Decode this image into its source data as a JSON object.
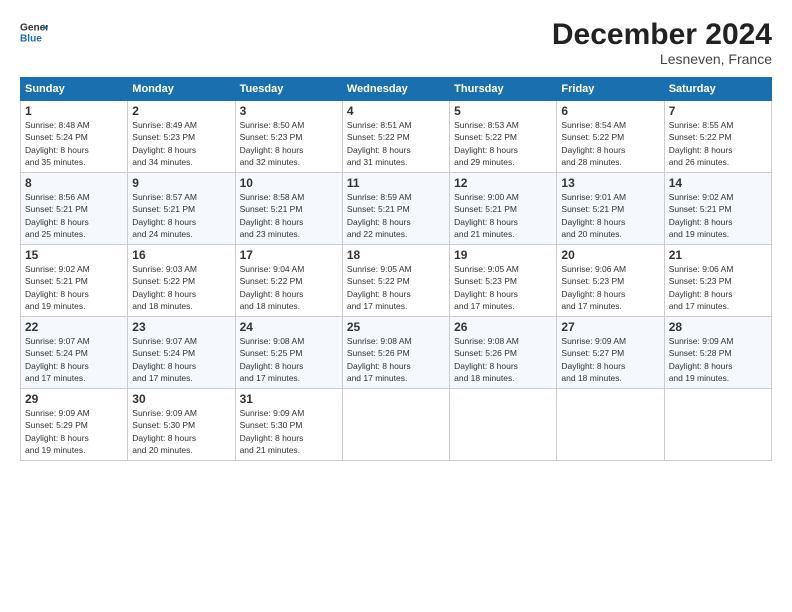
{
  "header": {
    "logo_line1": "General",
    "logo_line2": "Blue",
    "title": "December 2024",
    "subtitle": "Lesneven, France"
  },
  "columns": [
    "Sunday",
    "Monday",
    "Tuesday",
    "Wednesday",
    "Thursday",
    "Friday",
    "Saturday"
  ],
  "weeks": [
    [
      {
        "day": "1",
        "info": "Sunrise: 8:48 AM\nSunset: 5:24 PM\nDaylight: 8 hours\nand 35 minutes."
      },
      {
        "day": "2",
        "info": "Sunrise: 8:49 AM\nSunset: 5:23 PM\nDaylight: 8 hours\nand 34 minutes."
      },
      {
        "day": "3",
        "info": "Sunrise: 8:50 AM\nSunset: 5:23 PM\nDaylight: 8 hours\nand 32 minutes."
      },
      {
        "day": "4",
        "info": "Sunrise: 8:51 AM\nSunset: 5:22 PM\nDaylight: 8 hours\nand 31 minutes."
      },
      {
        "day": "5",
        "info": "Sunrise: 8:53 AM\nSunset: 5:22 PM\nDaylight: 8 hours\nand 29 minutes."
      },
      {
        "day": "6",
        "info": "Sunrise: 8:54 AM\nSunset: 5:22 PM\nDaylight: 8 hours\nand 28 minutes."
      },
      {
        "day": "7",
        "info": "Sunrise: 8:55 AM\nSunset: 5:22 PM\nDaylight: 8 hours\nand 26 minutes."
      }
    ],
    [
      {
        "day": "8",
        "info": "Sunrise: 8:56 AM\nSunset: 5:21 PM\nDaylight: 8 hours\nand 25 minutes."
      },
      {
        "day": "9",
        "info": "Sunrise: 8:57 AM\nSunset: 5:21 PM\nDaylight: 8 hours\nand 24 minutes."
      },
      {
        "day": "10",
        "info": "Sunrise: 8:58 AM\nSunset: 5:21 PM\nDaylight: 8 hours\nand 23 minutes."
      },
      {
        "day": "11",
        "info": "Sunrise: 8:59 AM\nSunset: 5:21 PM\nDaylight: 8 hours\nand 22 minutes."
      },
      {
        "day": "12",
        "info": "Sunrise: 9:00 AM\nSunset: 5:21 PM\nDaylight: 8 hours\nand 21 minutes."
      },
      {
        "day": "13",
        "info": "Sunrise: 9:01 AM\nSunset: 5:21 PM\nDaylight: 8 hours\nand 20 minutes."
      },
      {
        "day": "14",
        "info": "Sunrise: 9:02 AM\nSunset: 5:21 PM\nDaylight: 8 hours\nand 19 minutes."
      }
    ],
    [
      {
        "day": "15",
        "info": "Sunrise: 9:02 AM\nSunset: 5:21 PM\nDaylight: 8 hours\nand 19 minutes."
      },
      {
        "day": "16",
        "info": "Sunrise: 9:03 AM\nSunset: 5:22 PM\nDaylight: 8 hours\nand 18 minutes."
      },
      {
        "day": "17",
        "info": "Sunrise: 9:04 AM\nSunset: 5:22 PM\nDaylight: 8 hours\nand 18 minutes."
      },
      {
        "day": "18",
        "info": "Sunrise: 9:05 AM\nSunset: 5:22 PM\nDaylight: 8 hours\nand 17 minutes."
      },
      {
        "day": "19",
        "info": "Sunrise: 9:05 AM\nSunset: 5:23 PM\nDaylight: 8 hours\nand 17 minutes."
      },
      {
        "day": "20",
        "info": "Sunrise: 9:06 AM\nSunset: 5:23 PM\nDaylight: 8 hours\nand 17 minutes."
      },
      {
        "day": "21",
        "info": "Sunrise: 9:06 AM\nSunset: 5:23 PM\nDaylight: 8 hours\nand 17 minutes."
      }
    ],
    [
      {
        "day": "22",
        "info": "Sunrise: 9:07 AM\nSunset: 5:24 PM\nDaylight: 8 hours\nand 17 minutes."
      },
      {
        "day": "23",
        "info": "Sunrise: 9:07 AM\nSunset: 5:24 PM\nDaylight: 8 hours\nand 17 minutes."
      },
      {
        "day": "24",
        "info": "Sunrise: 9:08 AM\nSunset: 5:25 PM\nDaylight: 8 hours\nand 17 minutes."
      },
      {
        "day": "25",
        "info": "Sunrise: 9:08 AM\nSunset: 5:26 PM\nDaylight: 8 hours\nand 17 minutes."
      },
      {
        "day": "26",
        "info": "Sunrise: 9:08 AM\nSunset: 5:26 PM\nDaylight: 8 hours\nand 18 minutes."
      },
      {
        "day": "27",
        "info": "Sunrise: 9:09 AM\nSunset: 5:27 PM\nDaylight: 8 hours\nand 18 minutes."
      },
      {
        "day": "28",
        "info": "Sunrise: 9:09 AM\nSunset: 5:28 PM\nDaylight: 8 hours\nand 19 minutes."
      }
    ],
    [
      {
        "day": "29",
        "info": "Sunrise: 9:09 AM\nSunset: 5:29 PM\nDaylight: 8 hours\nand 19 minutes."
      },
      {
        "day": "30",
        "info": "Sunrise: 9:09 AM\nSunset: 5:30 PM\nDaylight: 8 hours\nand 20 minutes."
      },
      {
        "day": "31",
        "info": "Sunrise: 9:09 AM\nSunset: 5:30 PM\nDaylight: 8 hours\nand 21 minutes."
      },
      {
        "day": "",
        "info": ""
      },
      {
        "day": "",
        "info": ""
      },
      {
        "day": "",
        "info": ""
      },
      {
        "day": "",
        "info": ""
      }
    ]
  ]
}
